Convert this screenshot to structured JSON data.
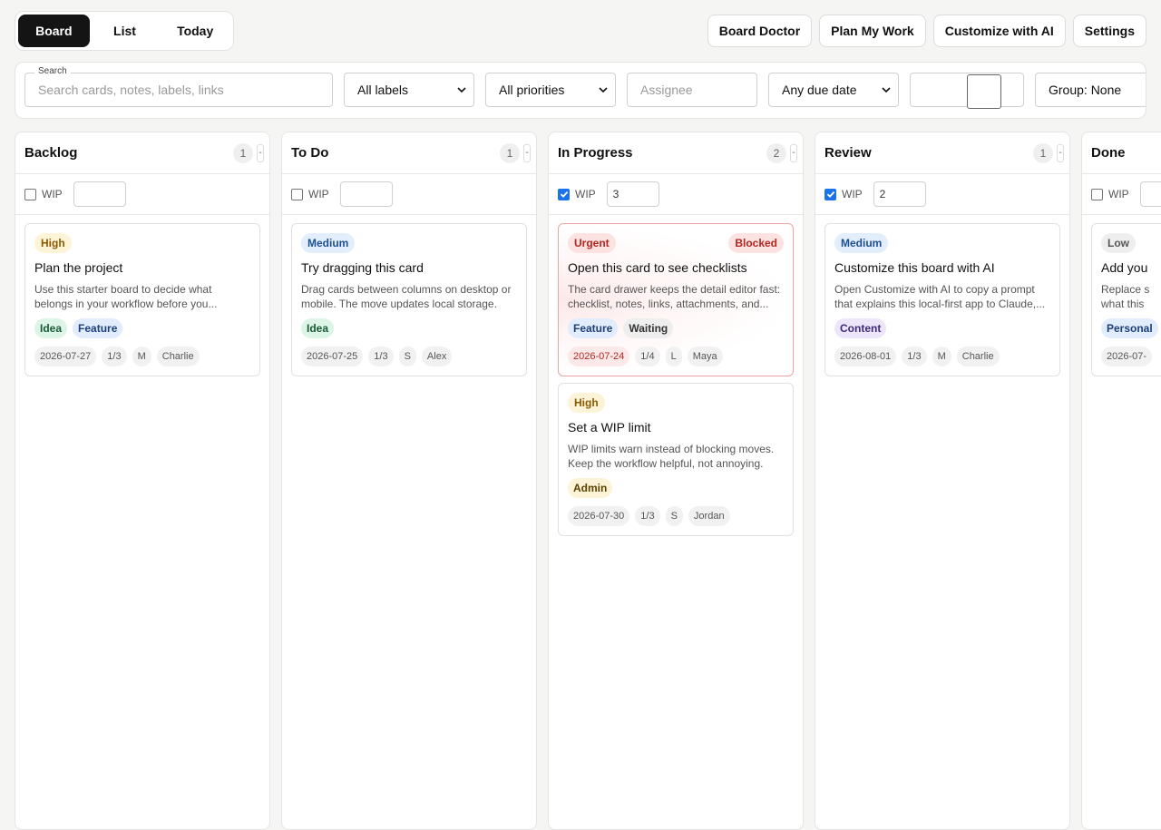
{
  "view_tabs": [
    {
      "label": "Board",
      "active": true
    },
    {
      "label": "List",
      "active": false
    },
    {
      "label": "Today",
      "active": false
    }
  ],
  "actions": [
    "Board Doctor",
    "Plan My Work",
    "Customize with AI",
    "Settings"
  ],
  "filters": {
    "search_legend": "Search",
    "search_placeholder": "Search cards, notes, labels, links",
    "labels_value": "All labels",
    "priorities_value": "All priorities",
    "assignee_placeholder": "Assignee",
    "due_value": "Any due date",
    "group_value": "Group: None"
  },
  "wip_label": "WIP",
  "columns": [
    {
      "title": "Backlog",
      "count": "1",
      "wip_checked": false,
      "wip_value": "",
      "cards": [
        {
          "priority": "High",
          "status": "",
          "title": "Plan the project",
          "desc": "Use this starter board to decide what belongs in your workflow before you...",
          "labels": [
            "Idea",
            "Feature"
          ],
          "due": "2026-07-27",
          "checklist": "1/3",
          "size": "M",
          "assignee": "Charlie"
        }
      ]
    },
    {
      "title": "To Do",
      "count": "1",
      "wip_checked": false,
      "wip_value": "",
      "cards": [
        {
          "priority": "Medium",
          "status": "",
          "title": "Try dragging this card",
          "desc": "Drag cards between columns on desktop or mobile. The move updates local storage.",
          "labels": [
            "Idea"
          ],
          "due": "2026-07-25",
          "checklist": "1/3",
          "size": "S",
          "assignee": "Alex"
        }
      ]
    },
    {
      "title": "In Progress",
      "count": "2",
      "wip_checked": true,
      "wip_value": "3",
      "cards": [
        {
          "priority": "Urgent",
          "status": "Blocked",
          "title": "Open this card to see checklists",
          "desc": "The card drawer keeps the detail editor fast: checklist, notes, links, attachments, and...",
          "labels": [
            "Feature",
            "Waiting"
          ],
          "due": "2026-07-24",
          "checklist": "1/4",
          "size": "L",
          "assignee": "Maya"
        },
        {
          "priority": "High",
          "status": "",
          "title": "Set a WIP limit",
          "desc": "WIP limits warn instead of blocking moves. Keep the workflow helpful, not annoying.",
          "labels": [
            "Admin"
          ],
          "due": "2026-07-30",
          "checklist": "1/3",
          "size": "S",
          "assignee": "Jordan"
        }
      ]
    },
    {
      "title": "Review",
      "count": "1",
      "wip_checked": true,
      "wip_value": "2",
      "cards": [
        {
          "priority": "Medium",
          "status": "",
          "title": "Customize this board with AI",
          "desc": "Open Customize with AI to copy a prompt that explains this local-first app to Claude,...",
          "labels": [
            "Content"
          ],
          "due": "2026-08-01",
          "checklist": "1/3",
          "size": "M",
          "assignee": "Charlie"
        }
      ]
    },
    {
      "title": "Done",
      "count": "",
      "wip_checked": false,
      "wip_value": "",
      "cards": [
        {
          "priority": "Low",
          "status": "",
          "title": "Add you",
          "desc": "Replace s what this",
          "labels": [
            "Personal"
          ],
          "due": "2026-07-",
          "checklist": "",
          "size": "",
          "assignee": ""
        }
      ]
    }
  ]
}
